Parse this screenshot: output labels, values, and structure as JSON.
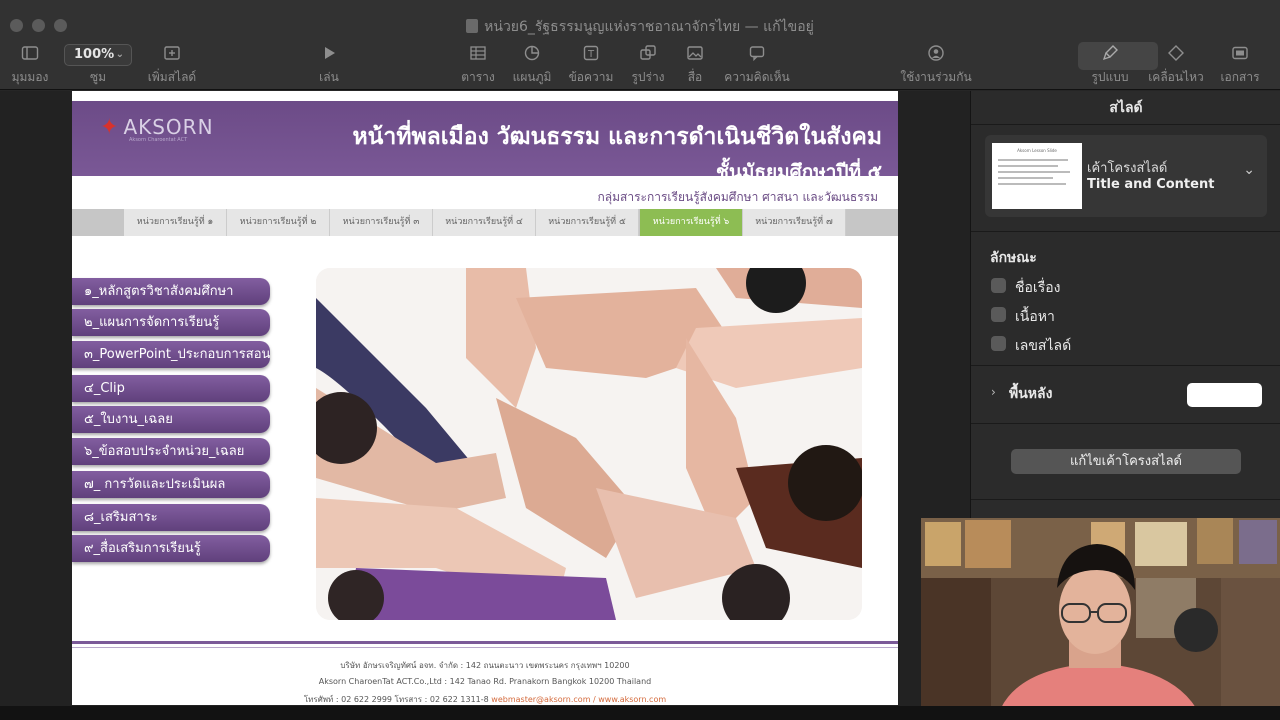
{
  "window": {
    "title": "หน่วย6_รัฐธรรมนูญแห่งราชอาณาจักรไทย — แก้ไขอยู่"
  },
  "toolbar": {
    "zoom_value": "100%",
    "items": {
      "view": "มุมมอง",
      "zoom": "ซูม",
      "add_slide": "เพิ่มสไลด์",
      "play": "เล่น",
      "table": "ตาราง",
      "chart": "แผนภูมิ",
      "text": "ข้อความ",
      "shape": "รูปร่าง",
      "media": "สื่อ",
      "comment": "ความคิดเห็น",
      "collaborate": "ใช้งานร่วมกัน",
      "format": "รูปแบบ",
      "animate": "เคลื่อนไหว",
      "document": "เอกสาร"
    }
  },
  "slide": {
    "logo_text": "AKSORN",
    "logo_sub": "Aksorn Charoentat ACT",
    "title": "หน้าที่พลเมือง วัฒนธรรม และการดำเนินชีวิตในสังคม",
    "grade": "ชั้นมัธยมศึกษาปีที่ ๕",
    "subject": "กลุ่มสาระการเรียนรู้สังคมศึกษา ศาสนา และวัฒนธรรม",
    "tabs": [
      "หน่วยการเรียนรู้ที่ ๑",
      "หน่วยการเรียนรู้ที่ ๒",
      "หน่วยการเรียนรู้ที่ ๓",
      "หน่วยการเรียนรู้ที่ ๔",
      "หน่วยการเรียนรู้ที่ ๕",
      "หน่วยการเรียนรู้ที่ ๖",
      "หน่วยการเรียนรู้ที่ ๗"
    ],
    "active_tab": "หน่วยการเรียนรู้ที่ ๖",
    "menu": [
      "๑_หลักสูตรวิชาสังคมศึกษา",
      "๒_แผนการจัดการเรียนรู้",
      "๓_PowerPoint_ประกอบการสอน",
      "๔_Clip",
      "๕_ใบงาน_เฉลย",
      "๖_ข้อสอบประจำหน่วย_เฉลย",
      "๗_ การวัดและประเมินผล",
      "๘_เสริมสาระ",
      "๙_สื่อเสริมการเรียนรู้"
    ],
    "footer": {
      "line1": "บริษัท อักษรเจริญทัศน์ อจท. จำกัด : 142 ถนนตะนาว เขตพระนคร กรุงเทพฯ 10200",
      "line2": "Aksorn CharoenTat ACT.Co.,Ltd : 142 Tanao Rd. Pranakorn Bangkok 10200 Thailand",
      "line3": "โทรศัพท์ : 02 622 2999  โทรสาร : 02 622 1311-8",
      "links": "webmaster@aksorn.com / www.aksorn.com"
    }
  },
  "inspector": {
    "header": "สไลด์",
    "layout_label": "เค้าโครงสไลด์",
    "layout_name": "Title and Content",
    "thumb_title": "Aksorn Lesson Slide",
    "appearance_label": "ลักษณะ",
    "checkboxes": [
      "ชื่อเรื่อง",
      "เนื้อหา",
      "เลขสไลด์"
    ],
    "background_label": "พื้นหลัง",
    "edit_layout_button": "แก้ไขเค้าโครงสไลด์",
    "background_color": "#ffffff"
  },
  "colors": {
    "header_purple": "#6c4b87",
    "active_tab_green": "#8dbd53",
    "menu_purple": "#6f4f8d"
  }
}
